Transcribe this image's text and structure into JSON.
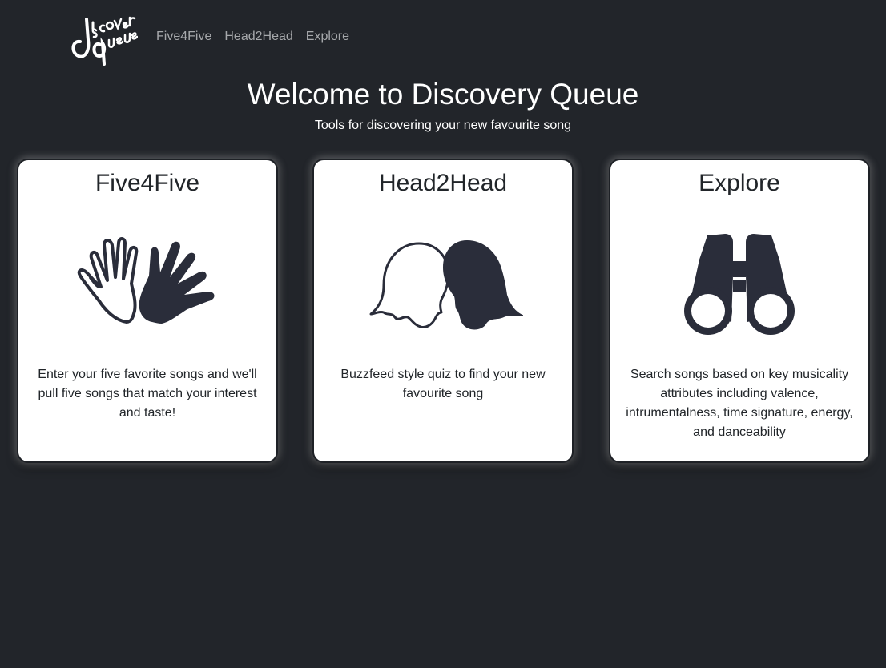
{
  "nav": {
    "logo_text": "discovery queue",
    "links": [
      "Five4Five",
      "Head2Head",
      "Explore"
    ]
  },
  "hero": {
    "title": "Welcome to Discovery Queue",
    "subtitle": "Tools for discovering your new favourite song"
  },
  "cards": [
    {
      "title": "Five4Five",
      "icon": "high-five-hands-icon",
      "description": "Enter your five favorite songs and we'll pull five songs that match your interest and taste!"
    },
    {
      "title": "Head2Head",
      "icon": "facing-heads-icon",
      "description": "Buzzfeed style quiz to find your new favourite song"
    },
    {
      "title": "Explore",
      "icon": "binoculars-icon",
      "description": "Search songs based on key musicality attributes including valence, intrumentalness, time signature, energy, and danceability"
    }
  ],
  "colors": {
    "background": "#22252a",
    "nav_link": "#a6a8ab",
    "card_bg": "#ffffff",
    "icon_fill": "#2a2d3a"
  }
}
